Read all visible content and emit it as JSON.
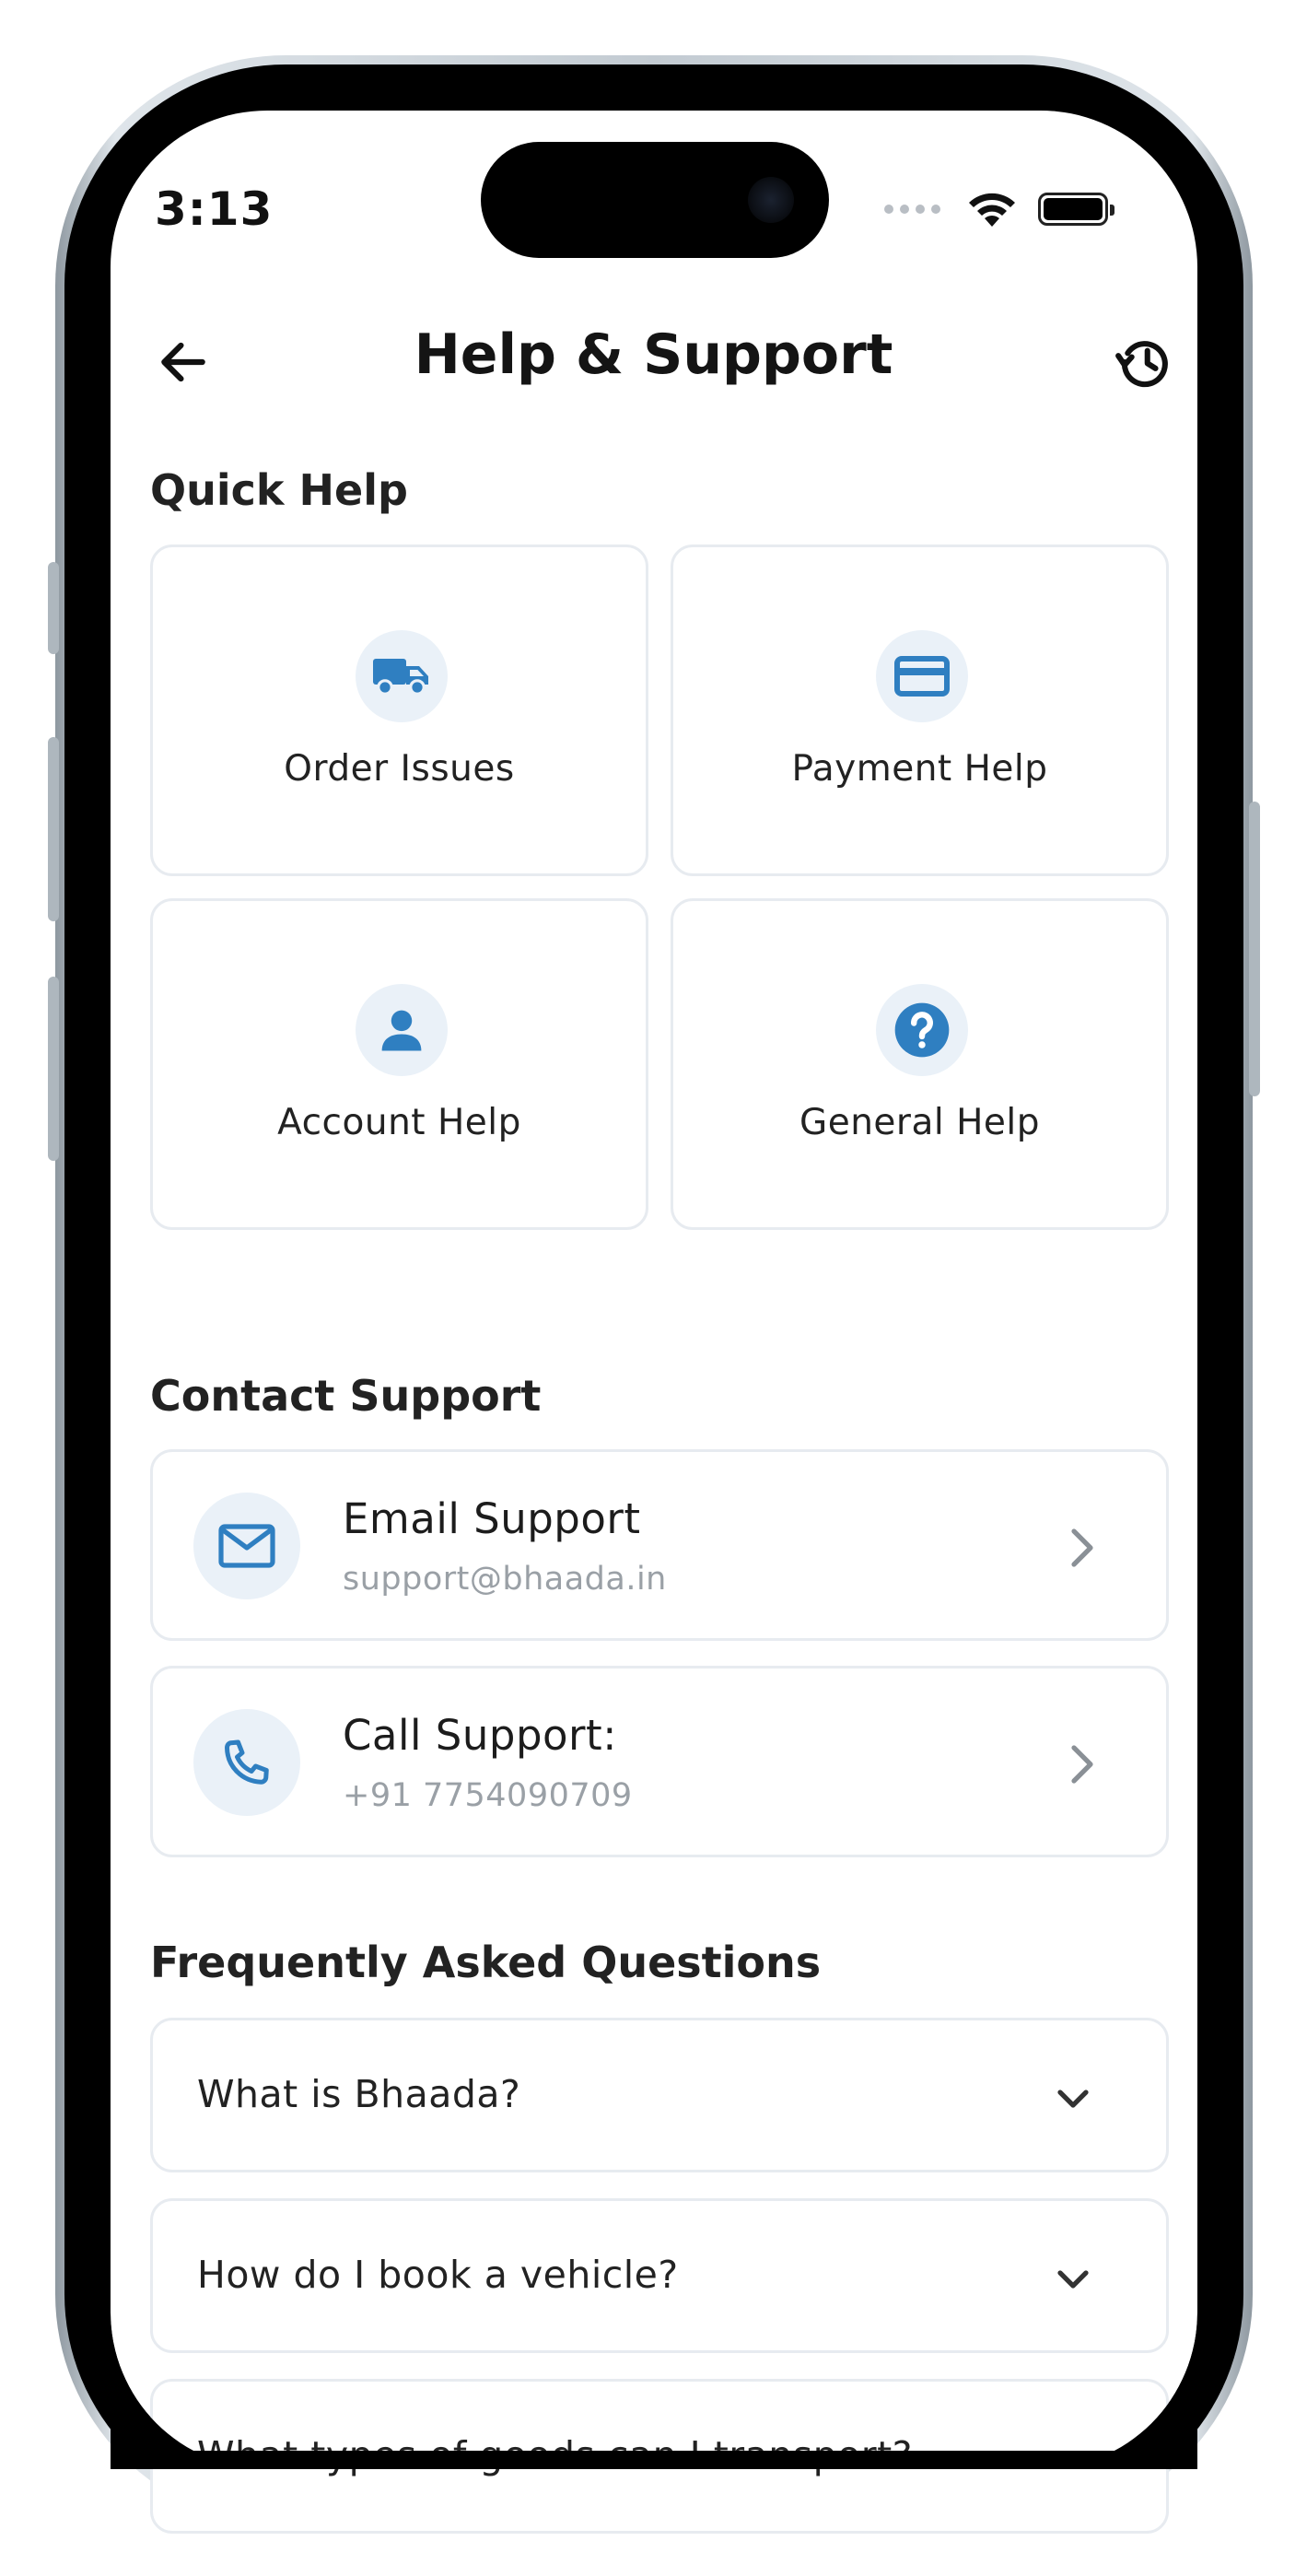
{
  "status_bar": {
    "time": "3:13"
  },
  "header": {
    "title": "Help & Support",
    "back_icon": "arrow-left-icon",
    "history_icon": "history-icon"
  },
  "quick_help": {
    "title": "Quick Help",
    "items": [
      {
        "label": "Order Issues",
        "icon": "truck-icon"
      },
      {
        "label": "Payment Help",
        "icon": "credit-card-icon"
      },
      {
        "label": "Account Help",
        "icon": "person-icon"
      },
      {
        "label": "General Help",
        "icon": "question-circle-icon"
      }
    ]
  },
  "contact_support": {
    "title": "Contact Support",
    "items": [
      {
        "title": "Email Support",
        "subtitle": "support@bhaada.in",
        "icon": "mail-icon"
      },
      {
        "title": "Call Support:",
        "subtitle": "+91 7754090709",
        "icon": "phone-icon"
      }
    ]
  },
  "faq": {
    "title": "Frequently Asked Questions",
    "items": [
      {
        "question": "What is Bhaada?"
      },
      {
        "question": "How do I book a vehicle?"
      },
      {
        "question": "What types of goods can I transport?"
      }
    ]
  },
  "colors": {
    "accent": "#2f7fc1",
    "icon_bg": "#eaf1f8",
    "card_border": "#e7ebf0",
    "subtitle": "#9aa0a6"
  }
}
